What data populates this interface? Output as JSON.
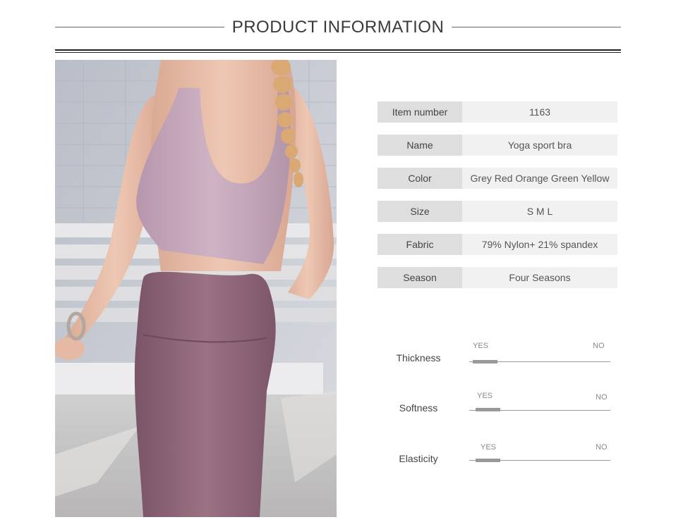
{
  "header": {
    "title": "PRODUCT INFORMATION"
  },
  "specs": [
    {
      "label": "Item number",
      "value": "1163"
    },
    {
      "label": "Name",
      "value": "Yoga sport bra"
    },
    {
      "label": "Color",
      "value": "Grey Red Orange Green Yellow"
    },
    {
      "label": "Size",
      "value": "S M L"
    },
    {
      "label": "Fabric",
      "value": "79% Nylon+ 21% spandex"
    },
    {
      "label": "Season",
      "value": "Four Seasons"
    }
  ],
  "ratings": [
    {
      "label": "Thickness",
      "yes": "YES",
      "no": "NO",
      "level": 0.1
    },
    {
      "label": "Softness",
      "yes": "YES",
      "no": "NO",
      "level": 0.12
    },
    {
      "label": "Elasticity",
      "yes": "YES",
      "no": "NO",
      "level": 0.12
    }
  ],
  "colors": {
    "label_bg": "#dedede",
    "value_bg": "#f1f1f1",
    "garment": "#a98a9c",
    "pants": "#8c6476"
  }
}
